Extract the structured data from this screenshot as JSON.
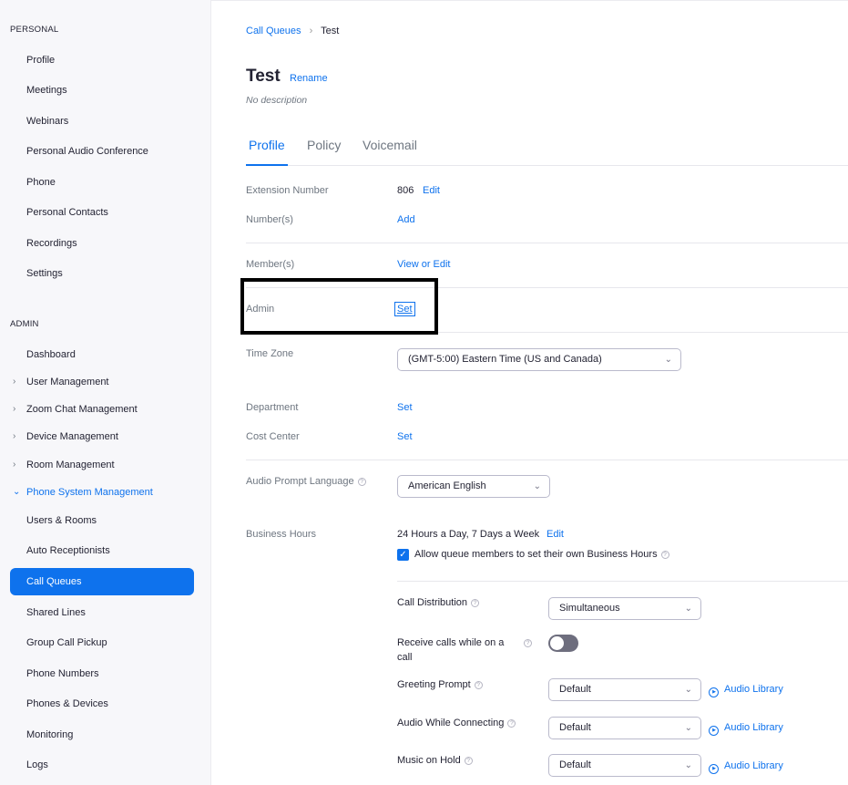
{
  "sidebar": {
    "personal_title": "PERSONAL",
    "personal_items": [
      "Profile",
      "Meetings",
      "Webinars",
      "Personal Audio Conference",
      "Phone",
      "Personal Contacts",
      "Recordings",
      "Settings"
    ],
    "admin_title": "ADMIN",
    "admin_items": {
      "dashboard": "Dashboard",
      "user_management": "User Management",
      "zoom_chat_management": "Zoom Chat Management",
      "device_management": "Device Management",
      "room_management": "Room Management",
      "phone_system_management": "Phone System Management",
      "users_rooms": "Users & Rooms",
      "auto_receptionists": "Auto Receptionists",
      "call_queues": "Call Queues",
      "shared_lines": "Shared Lines",
      "group_call_pickup": "Group Call Pickup",
      "phone_numbers": "Phone Numbers",
      "phones_devices": "Phones & Devices",
      "monitoring": "Monitoring",
      "logs": "Logs"
    },
    "chevron_icon": "chevron-right-icon",
    "expanded_chevron_icon": "chevron-down-icon"
  },
  "breadcrumb": {
    "parent": "Call Queues",
    "separator": "›",
    "current": "Test"
  },
  "header": {
    "title": "Test",
    "rename": "Rename",
    "description": "No description"
  },
  "tabs": [
    "Profile",
    "Policy",
    "Voicemail"
  ],
  "fields": {
    "extension_label": "Extension Number",
    "extension_value": "806",
    "extension_edit": "Edit",
    "numbers_label": "Number(s)",
    "numbers_add": "Add",
    "members_label": "Member(s)",
    "members_link": "View or Edit",
    "admin_label": "Admin",
    "admin_set": "Set",
    "timezone_label": "Time Zone",
    "timezone_value": "(GMT-5:00) Eastern Time (US and Canada)",
    "department_label": "Department",
    "department_set": "Set",
    "cost_center_label": "Cost Center",
    "cost_center_set": "Set",
    "audio_prompt_label": "Audio Prompt Language",
    "audio_prompt_value": "American English",
    "business_hours_label": "Business Hours",
    "business_hours_value": "24 Hours a Day, 7 Days a Week",
    "business_hours_edit": "Edit",
    "allow_members_label": "Allow queue members to set their own Business Hours",
    "allow_members_checked": true,
    "call_distribution_label": "Call Distribution",
    "call_distribution_value": "Simultaneous",
    "receive_calls_label": "Receive calls while on a call",
    "receive_calls_on": false,
    "greeting_label": "Greeting Prompt",
    "greeting_value": "Default",
    "audio_connecting_label": "Audio While Connecting",
    "audio_connecting_value": "Default",
    "music_hold_label": "Music on Hold",
    "music_hold_value": "Default",
    "audio_library": "Audio Library"
  },
  "icons": {
    "help": "question-circle-icon",
    "caret": "chevron-down-icon",
    "play": "play-circle-icon",
    "check": "checkmark-icon"
  },
  "colors": {
    "accent": "#0e72ed",
    "sidebar_bg": "#f7f7fa",
    "text": "#232333",
    "muted": "#6e7680"
  }
}
